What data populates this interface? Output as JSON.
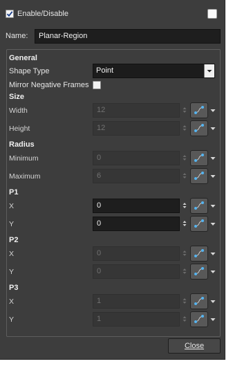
{
  "header": {
    "enable_label": "Enable/Disable",
    "enable_checked": true,
    "right_checked": false
  },
  "name": {
    "label": "Name:",
    "value": "Planar-Region"
  },
  "general": {
    "title": "General",
    "shape_type_label": "Shape Type",
    "shape_type_value": "Point",
    "mirror_label": "Mirror Negative Frames",
    "mirror_checked": false
  },
  "size": {
    "title": "Size",
    "width_label": "Width",
    "width_value": "12",
    "height_label": "Height",
    "height_value": "12"
  },
  "radius": {
    "title": "Radius",
    "minimum_label": "Minimum",
    "minimum_value": "0",
    "maximum_label": "Maximum",
    "maximum_value": "6"
  },
  "p1": {
    "title": "P1",
    "x_label": "X",
    "x_value": "0",
    "y_label": "Y",
    "y_value": "0"
  },
  "p2": {
    "title": "P2",
    "x_label": "X",
    "x_value": "0",
    "y_label": "Y",
    "y_value": "0"
  },
  "p3": {
    "title": "P3",
    "x_label": "X",
    "x_value": "1",
    "y_label": "Y",
    "y_value": "1"
  },
  "footer": {
    "close_label": "Close"
  },
  "colors": {
    "panel_bg": "#3d3d3d",
    "field_bg": "#1e1e1e",
    "function_icon_blue": "#55b4f0"
  },
  "icons": {
    "function_button": "function-curve-icon",
    "spinner": "spinner-arrows-icon",
    "dropdown": "chevron-down-icon"
  }
}
